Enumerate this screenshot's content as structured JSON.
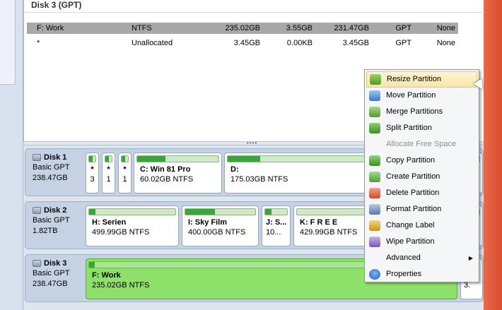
{
  "top": {
    "disk_title": "Disk 3 (GPT)",
    "rows": [
      {
        "name": "F: Work",
        "fs": "NTFS",
        "capacity": "235.02GB",
        "used": "3.55GB",
        "unused": "231.47GB",
        "type": "GPT",
        "status": "None",
        "selected": true
      },
      {
        "name": "*",
        "fs": "Unallocated",
        "capacity": "3.45GB",
        "used": "0.00KB",
        "unused": "3.45GB",
        "type": "GPT",
        "status": "None",
        "selected": false
      }
    ]
  },
  "disks": [
    {
      "name": "Disk 1",
      "kind": "Basic GPT",
      "size": "238.47GB",
      "partitions": [
        {
          "label": "*",
          "sub": "3",
          "used": 0.5,
          "small": true
        },
        {
          "label": "*",
          "sub": "1",
          "used": 0.5,
          "small": true
        },
        {
          "label": "*",
          "sub": "1",
          "used": 0.5,
          "small": true
        },
        {
          "label": "C: Win 81 Pro",
          "sub": "60.02GB NTFS",
          "used": 0.35
        },
        {
          "label": "D:",
          "sub": "175.03GB NTFS",
          "used": 0.13
        }
      ]
    },
    {
      "name": "Disk 2",
      "kind": "Basic GPT",
      "size": "1.82TB",
      "partitions": [
        {
          "label": "H: Serien",
          "sub": "499.99GB NTFS",
          "used": 0.07
        },
        {
          "label": "I: Sky Film",
          "sub": "400.00GB NTFS",
          "used": 0.42
        },
        {
          "label": "J: S...",
          "sub": "10...",
          "used": 0.3
        },
        {
          "label": "K: F R E E",
          "sub": "429.99GB NTFS",
          "used": 0.0
        }
      ]
    },
    {
      "name": "Disk 3",
      "kind": "Basic GPT",
      "size": "238.47GB",
      "partitions": [
        {
          "label": "F: Work",
          "sub": "235.02GB NTFS",
          "used": 0.015,
          "selected": true
        },
        {
          "label": "",
          "sub": "3.",
          "used": 0.0
        }
      ]
    }
  ],
  "context_menu": {
    "items": [
      {
        "label": "Resize Partition",
        "icon": "resize-icon",
        "cls": "ico-resize",
        "hover": true
      },
      {
        "label": "Move Partition",
        "icon": "move-icon",
        "cls": "ico-move"
      },
      {
        "label": "Merge Partitions",
        "icon": "merge-icon",
        "cls": "ico-merge"
      },
      {
        "label": "Split Partition",
        "icon": "split-icon",
        "cls": "ico-split"
      },
      {
        "label": "Allocate Free Space",
        "icon": "",
        "cls": "",
        "disabled": true
      },
      {
        "label": "Copy Partition",
        "icon": "copy-icon",
        "cls": "ico-copy"
      },
      {
        "label": "Create Partition",
        "icon": "create-icon",
        "cls": "ico-create"
      },
      {
        "label": "Delete Partition",
        "icon": "delete-icon",
        "cls": "ico-delete"
      },
      {
        "label": "Format Partition",
        "icon": "format-icon",
        "cls": "ico-format"
      },
      {
        "label": "Change Label",
        "icon": "label-icon",
        "cls": "ico-label"
      },
      {
        "label": "Wipe Partition",
        "icon": "wipe-icon",
        "cls": "ico-wipe"
      },
      {
        "label": "Advanced",
        "icon": "",
        "cls": "",
        "submenu": true
      },
      {
        "label": "Properties",
        "icon": "properties-icon",
        "cls": "ico-prop"
      }
    ]
  }
}
